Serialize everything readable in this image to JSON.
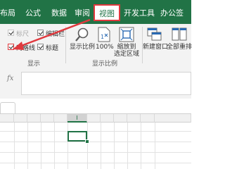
{
  "tabs": [
    {
      "label": "布局"
    },
    {
      "label": "公式"
    },
    {
      "label": "数据"
    },
    {
      "label": "审阅"
    },
    {
      "label": "视图"
    },
    {
      "label": "开发工具"
    },
    {
      "label": "办公签"
    }
  ],
  "show_group": {
    "ruler": {
      "label": "标尺",
      "checked": true,
      "disabled": true
    },
    "formula_bar": {
      "label": "编辑栏",
      "checked": true
    },
    "gridlines": {
      "label": "网格线",
      "checked": true
    },
    "headings": {
      "label": "标题",
      "checked": true
    },
    "group_label": "显示"
  },
  "zoom_group": {
    "zoom_button": "显示比例",
    "zoom_100_button": "100%",
    "zoom_selection_line1": "缩放到",
    "zoom_selection_line2": "选定区域",
    "group_label": "显示比例"
  },
  "window_group": {
    "new_window_button": "新建窗口",
    "arrange_all_button": "全部重排"
  },
  "formula_bar": {
    "fx_label": "fx"
  },
  "columns": [
    "",
    "",
    "",
    "",
    "",
    "I",
    "",
    "",
    "",
    "",
    "",
    ""
  ],
  "accent_color": "#217346",
  "annotation_color": "#e0393e"
}
